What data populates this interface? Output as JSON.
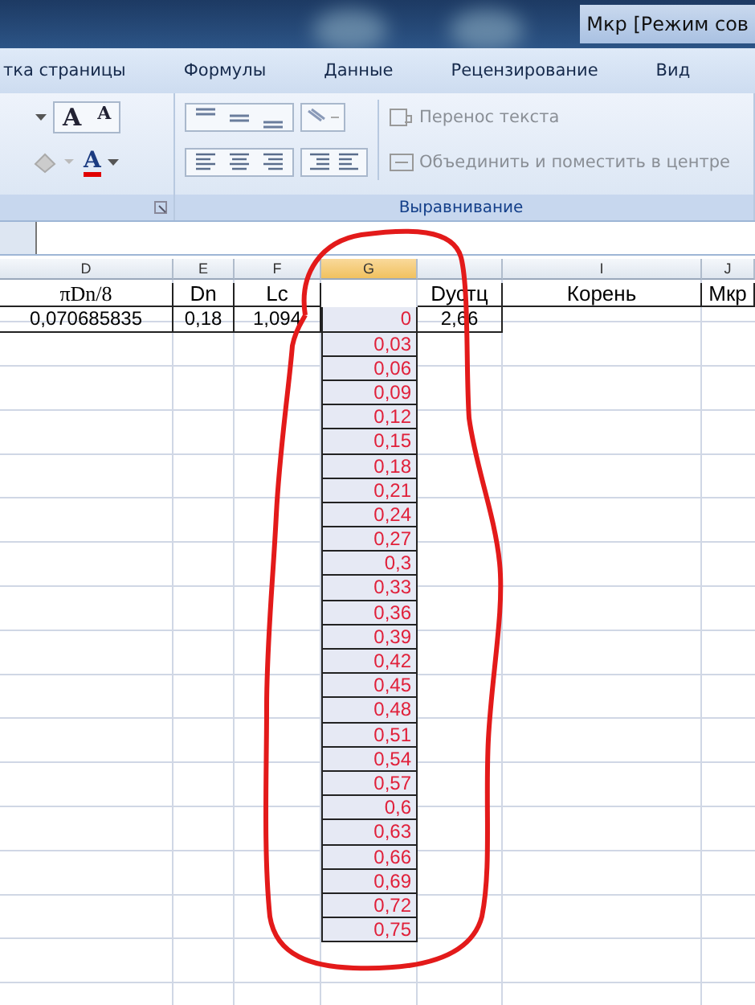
{
  "window": {
    "title": "Мкр  [Режим сов"
  },
  "tabs": [
    {
      "label": "тка страницы",
      "selected": false
    },
    {
      "label": "Формулы",
      "selected": false
    },
    {
      "label": "Данные",
      "selected": false
    },
    {
      "label": "Рецензирование",
      "selected": false
    },
    {
      "label": "Вид",
      "selected": false
    }
  ],
  "ribbon": {
    "grow_font": "A",
    "shrink_font": "A",
    "font_color": "A",
    "wrap_text": {
      "label": "Перенос текста",
      "disabled": true
    },
    "merge_center": {
      "label": "Объединить и поместить в центре",
      "disabled": true
    },
    "group_label": "Выравнивание"
  },
  "columns": [
    {
      "label": "D",
      "selected": false
    },
    {
      "label": "E",
      "selected": false
    },
    {
      "label": "F",
      "selected": false
    },
    {
      "label": "G",
      "selected": true
    },
    {
      "selected": false
    },
    {
      "label": "I",
      "selected": false
    },
    {
      "label": "J",
      "selected": false
    }
  ],
  "rows": [
    {
      "d": "πDn/8",
      "e": "Dn",
      "f": "Lc",
      "h": "Dустц",
      "i": "Корень",
      "j": "Мкр"
    },
    {
      "d": "0,070685835",
      "e": "0,18",
      "f": "1,094",
      "g": "0",
      "h": "2,66"
    },
    {
      "g": "0,03"
    },
    {
      "g": "0,06"
    },
    {
      "g": "0,09"
    },
    {
      "g": "0,12"
    },
    {
      "g": "0,15"
    },
    {
      "g": "0,18"
    },
    {
      "g": "0,21"
    },
    {
      "g": "0,24"
    },
    {
      "g": "0,27"
    },
    {
      "g": "0,3"
    },
    {
      "g": "0,33"
    },
    {
      "g": "0,36"
    },
    {
      "g": "0,39"
    },
    {
      "g": "0,42"
    },
    {
      "g": "0,45"
    },
    {
      "g": "0,48"
    },
    {
      "g": "0,51"
    },
    {
      "g": "0,54"
    },
    {
      "g": "0,57"
    },
    {
      "g": "0,6"
    },
    {
      "g": "0,63"
    },
    {
      "g": "0,66"
    },
    {
      "g": "0,69"
    },
    {
      "g": "0,72"
    },
    {
      "g": "0,75"
    },
    {},
    {},
    {}
  ]
}
